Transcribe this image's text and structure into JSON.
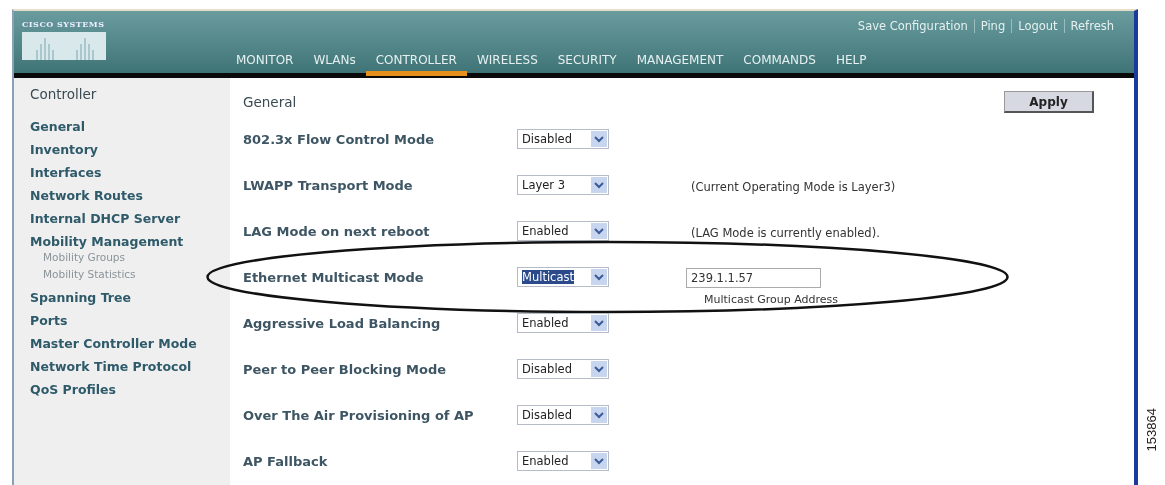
{
  "logo": {
    "text": "CISCO SYSTEMS"
  },
  "top_links": [
    "Save Configuration",
    "Ping",
    "Logout",
    "Refresh"
  ],
  "nav": [
    {
      "label": "MONITOR",
      "selected": false
    },
    {
      "label": "WLANs",
      "selected": false
    },
    {
      "label": "CONTROLLER",
      "selected": true
    },
    {
      "label": "WIRELESS",
      "selected": false
    },
    {
      "label": "SECURITY",
      "selected": false
    },
    {
      "label": "MANAGEMENT",
      "selected": false
    },
    {
      "label": "COMMANDS",
      "selected": false
    },
    {
      "label": "HELP",
      "selected": false
    }
  ],
  "sidebar": {
    "title": "Controller",
    "items": [
      {
        "label": "General"
      },
      {
        "label": "Inventory"
      },
      {
        "label": "Interfaces"
      },
      {
        "label": "Network Routes"
      },
      {
        "label": "Internal DHCP Server"
      },
      {
        "label": "Mobility Management",
        "children": [
          {
            "label": "Mobility Groups"
          },
          {
            "label": "Mobility Statistics"
          }
        ]
      },
      {
        "label": "Spanning Tree"
      },
      {
        "label": "Ports"
      },
      {
        "label": "Master Controller Mode"
      },
      {
        "label": "Network Time Protocol"
      },
      {
        "label": "QoS Profiles"
      }
    ]
  },
  "content": {
    "title": "General",
    "apply_button": "Apply",
    "rows": [
      {
        "label": "802.3x Flow Control Mode",
        "select": {
          "value": "Disabled",
          "focused": false
        },
        "highlighted": false
      },
      {
        "label": "LWAPP Transport Mode",
        "select": {
          "value": "Layer 3",
          "focused": false
        },
        "note": "(Current Operating Mode is Layer3)",
        "highlighted": false
      },
      {
        "label": "LAG Mode on next reboot",
        "select": {
          "value": "Enabled",
          "focused": false
        },
        "note": "(LAG Mode is currently enabled).",
        "highlighted": false
      },
      {
        "label": "Ethernet Multicast Mode",
        "select": {
          "value": "Multicast",
          "focused": true
        },
        "field": {
          "value": "239.1.1.57",
          "caption": "Multicast Group Address"
        },
        "highlighted": true
      },
      {
        "label": "Aggressive Load Balancing",
        "select": {
          "value": "Enabled",
          "focused": false
        },
        "highlighted": false
      },
      {
        "label": "Peer to Peer Blocking Mode",
        "select": {
          "value": "Disabled",
          "focused": false
        },
        "highlighted": false
      },
      {
        "label": "Over The Air Provisioning of AP",
        "select": {
          "value": "Disabled",
          "focused": false
        },
        "highlighted": false
      },
      {
        "label": "AP Fallback",
        "select": {
          "value": "Enabled",
          "focused": false
        },
        "highlighted": false
      }
    ]
  },
  "figure_number": "153864"
}
